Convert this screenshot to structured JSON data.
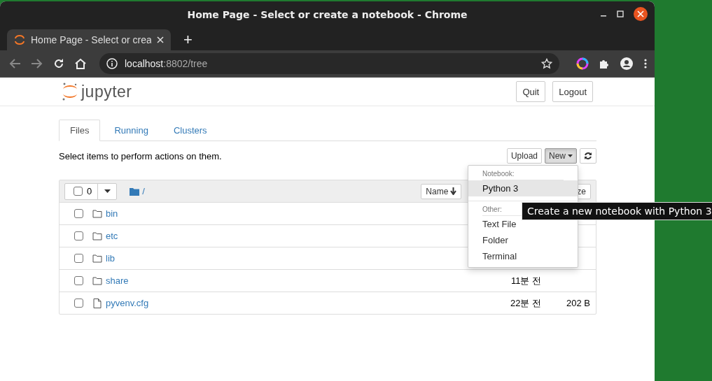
{
  "window": {
    "title": "Home Page - Select or create a notebook - Chrome"
  },
  "browser_tabs": [
    {
      "title": "Home Page - Select or crea",
      "selected": true
    }
  ],
  "new_tab": "+",
  "address_bar": {
    "host": "localhost",
    "path": ":8802/tree"
  },
  "header": {
    "logo_text": "jupyter",
    "buttons": [
      "Quit",
      "Logout"
    ]
  },
  "tabs": [
    {
      "label": "Files",
      "selected": true
    },
    {
      "label": "Running",
      "selected": false
    },
    {
      "label": "Clusters",
      "selected": false
    }
  ],
  "toolbar": {
    "hint": "Select items to perform actions on them.",
    "upload": "Upload",
    "new": "New"
  },
  "file_list": {
    "select_count": "0",
    "select_all_checked": false,
    "path": "/",
    "sort_buttons": [
      "Name",
      "ze"
    ],
    "rows": [
      {
        "name": "bin",
        "kind": "folder",
        "checked": false
      },
      {
        "name": "etc",
        "kind": "folder",
        "checked": false
      },
      {
        "name": "lib",
        "kind": "folder",
        "checked": false
      },
      {
        "name": "share",
        "kind": "folder",
        "checked": false,
        "modified": "11분 전"
      },
      {
        "name": "pyvenv.cfg",
        "kind": "file",
        "checked": false,
        "modified": "22분 전",
        "size": "202 B"
      }
    ]
  },
  "new_menu": {
    "sections": [
      {
        "header": "Notebook:",
        "items": [
          {
            "label": "Python 3",
            "selected": true
          }
        ]
      },
      {
        "header": "Other:",
        "items": [
          {
            "label": "Text File",
            "selected": false
          },
          {
            "label": "Folder",
            "selected": false
          },
          {
            "label": "Terminal",
            "selected": false
          }
        ]
      }
    ]
  },
  "tooltip": "Create a new notebook with Python 3"
}
